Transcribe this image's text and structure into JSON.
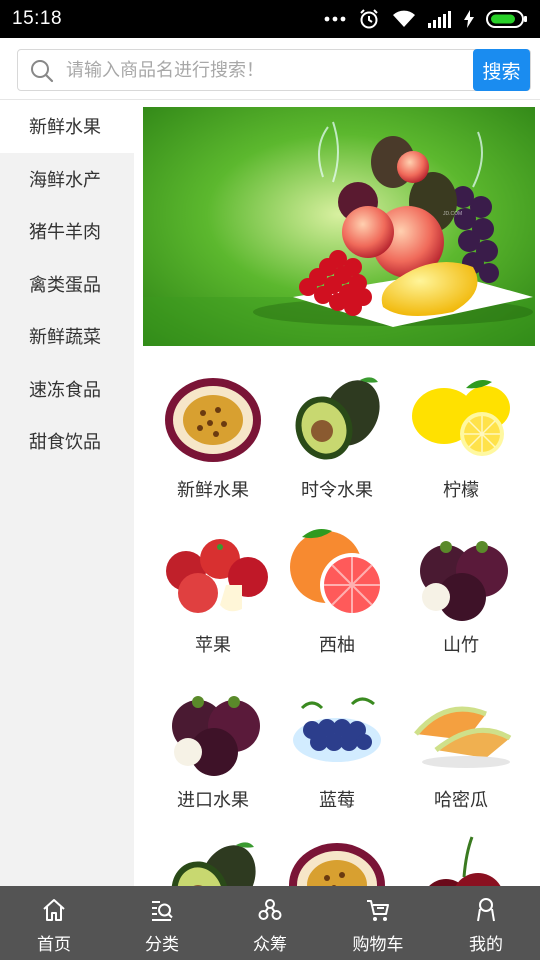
{
  "status_bar": {
    "time": "15:18"
  },
  "search": {
    "placeholder": "请输入商品名进行搜索！",
    "button_label": "搜索"
  },
  "sidebar": {
    "items": [
      {
        "label": "新鲜水果",
        "active": true
      },
      {
        "label": "海鲜水产",
        "active": false
      },
      {
        "label": "猪牛羊肉",
        "active": false
      },
      {
        "label": "禽类蛋品",
        "active": false
      },
      {
        "label": "新鲜蔬菜",
        "active": false
      },
      {
        "label": "速冻食品",
        "active": false
      },
      {
        "label": "甜食饮品",
        "active": false
      }
    ]
  },
  "banner": {
    "watermark": "JD.COM"
  },
  "products": [
    {
      "label": "新鲜水果",
      "icon": "passion-fruit"
    },
    {
      "label": "时令水果",
      "icon": "avocado"
    },
    {
      "label": "柠檬",
      "icon": "lemon"
    },
    {
      "label": "苹果",
      "icon": "apple"
    },
    {
      "label": "西柚",
      "icon": "grapefruit"
    },
    {
      "label": "山竹",
      "icon": "mangosteen"
    },
    {
      "label": "进口水果",
      "icon": "mangosteen"
    },
    {
      "label": "蓝莓",
      "icon": "blueberry"
    },
    {
      "label": "哈密瓜",
      "icon": "melon"
    },
    {
      "label": "",
      "icon": "avocado"
    },
    {
      "label": "",
      "icon": "passion-fruit"
    },
    {
      "label": "",
      "icon": "cherry"
    }
  ],
  "bottom_nav": {
    "items": [
      {
        "label": "首页",
        "icon": "home-icon"
      },
      {
        "label": "分类",
        "icon": "category-search-icon"
      },
      {
        "label": "众筹",
        "icon": "crowdfunding-icon"
      },
      {
        "label": "购物车",
        "icon": "cart-icon"
      },
      {
        "label": "我的",
        "icon": "profile-icon"
      }
    ]
  },
  "colors": {
    "accent": "#1a8cf0",
    "nav_bg": "#545454",
    "sidebar_bg": "#f2f2f2"
  }
}
